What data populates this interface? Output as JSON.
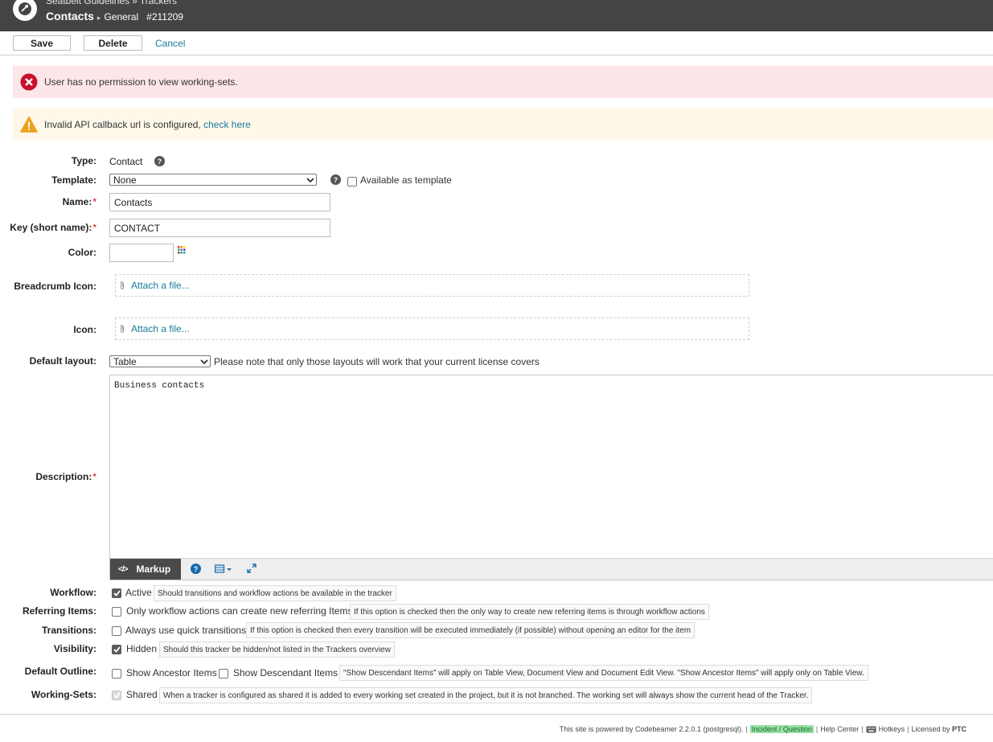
{
  "header": {
    "project": "Seatbelt Guidelines",
    "section": "Trackers",
    "title": "Contacts",
    "category": "General",
    "id": "#211209"
  },
  "toolbar": {
    "save": "Save",
    "delete": "Delete",
    "cancel": "Cancel"
  },
  "alerts": {
    "error": "User has no permission to view working-sets.",
    "warning": "Invalid API callback url is configured,",
    "warning_link": "check here"
  },
  "form": {
    "type": {
      "label": "Type:",
      "value": "Contact"
    },
    "template": {
      "label": "Template:",
      "value": "None",
      "available_label": "Available as template"
    },
    "name": {
      "label": "Name:",
      "value": "Contacts"
    },
    "key": {
      "label": "Key (short name):",
      "value": "CONTACT"
    },
    "color": {
      "label": "Color:",
      "value": ""
    },
    "breadcrumb_icon": {
      "label": "Breadcrumb Icon:",
      "attach": "Attach a file..."
    },
    "icon": {
      "label": "Icon:",
      "attach": "Attach a file..."
    },
    "default_layout": {
      "label": "Default layout:",
      "value": "Table",
      "note": "Please note that only those layouts will work that your current license covers"
    },
    "description": {
      "label": "Description:",
      "value": "Business contacts",
      "markup_label": "Markup"
    },
    "workflow": {
      "label": "Workflow:",
      "option": "Active",
      "checked": true,
      "hint": "Should transitions and workflow actions be available in the tracker"
    },
    "referring_items": {
      "label": "Referring Items:",
      "option": "Only workflow actions can create new referring Items",
      "checked": false,
      "hint": "If this option is checked then the only way to create new referring items is through workflow actions"
    },
    "transitions": {
      "label": "Transitions:",
      "option": "Always use quick transitions",
      "checked": false,
      "hint": "If this option is checked then every transition will be executed immediately (if possible) without opening an editor for the item"
    },
    "visibility": {
      "label": "Visibility:",
      "option": "Hidden",
      "checked": true,
      "hint": "Should this tracker be hidden/not listed in the Trackers overview"
    },
    "default_outline": {
      "label": "Default Outline:",
      "option1": "Show Ancestor Items",
      "option2": "Show Descendant Items",
      "hint": "\"Show Descendant Items\" will apply on Table View, Document View and Document Edit View. \"Show Ancestor Items\" will apply only on Table View."
    },
    "working_sets": {
      "label": "Working-Sets:",
      "option": "Shared",
      "checked": true,
      "disabled": true,
      "hint": "When a tracker is configured as shared it is added to every working set created in the project, but it is not branched. The working set will always show the current head of the Tracker."
    }
  },
  "footer": {
    "powered": "This site is powered by",
    "product": "Codebeamer",
    "version": "2.2.0.1 (postgresql).",
    "incident": "Incident / Question",
    "help": "Help Center",
    "hotkeys": "Hotkeys",
    "licensed": "Licensed by",
    "vendor": "PTC"
  },
  "colors": {
    "header_bg": "#444444",
    "link": "#187a9e",
    "error_bg": "#fce6e8",
    "warning_bg": "#fff8ea",
    "incident_bg": "#98e0a4"
  }
}
